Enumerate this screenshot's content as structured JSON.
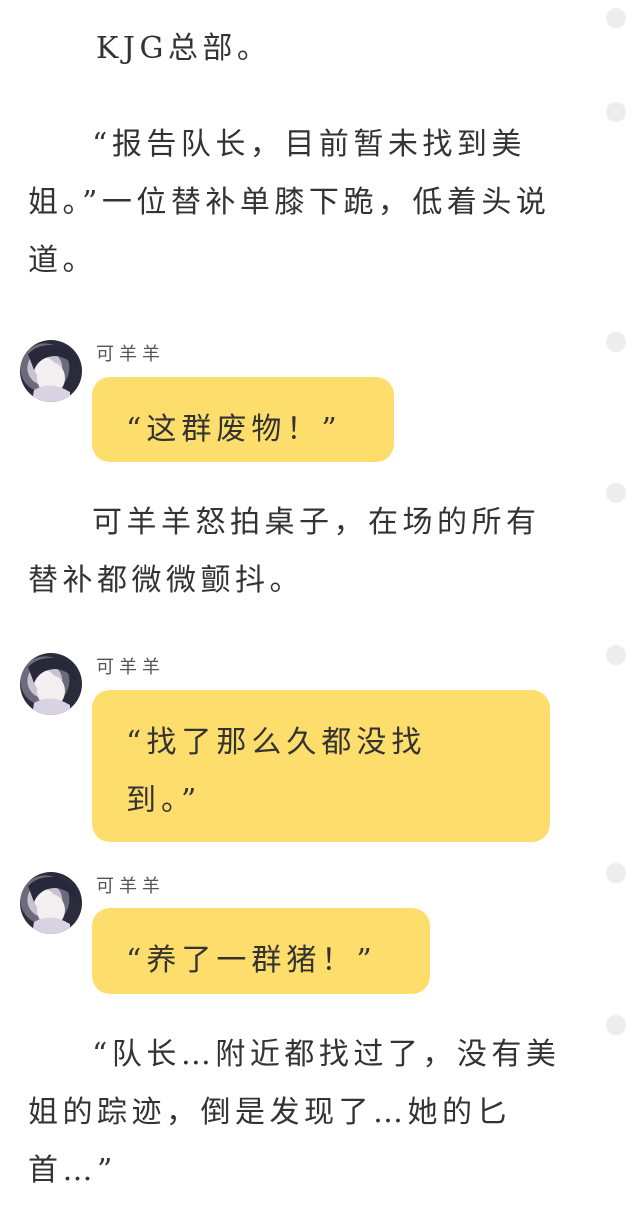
{
  "content": [
    {
      "type": "narration",
      "text": "KJG总部。"
    },
    {
      "type": "narration",
      "text": "“报告队长，目前暂未找到美姐。”一位替补单膝下跪，低着头说道。"
    },
    {
      "type": "dialogue",
      "speaker": "可羊羊",
      "text": "“这群废物！”"
    },
    {
      "type": "narration",
      "text": "可羊羊怒拍桌子，在场的所有替补都微微颤抖。"
    },
    {
      "type": "dialogue",
      "speaker": "可羊羊",
      "text": "“找了那么久都没找到。”"
    },
    {
      "type": "dialogue",
      "speaker": "可羊羊",
      "text": "“养了一群猪！”"
    },
    {
      "type": "narration",
      "text": "“队长…附近都找过了，没有美姐的踪迹，倒是发现了…她的匕首…”"
    }
  ],
  "colors": {
    "bubble": "#fddd6c",
    "text": "#333333",
    "comment_dot": "#ededed"
  },
  "icons": {
    "avatar": "character-avatar",
    "side_marker": "comment-dot-icon"
  }
}
